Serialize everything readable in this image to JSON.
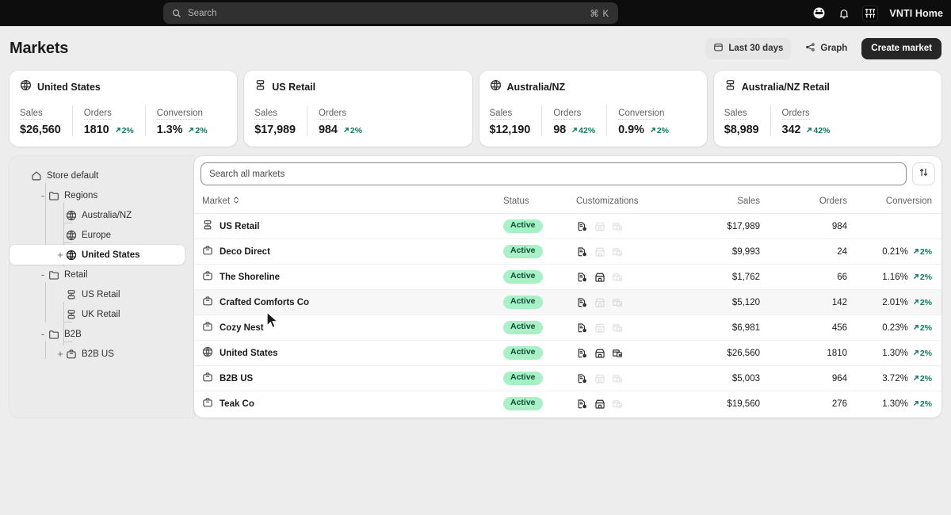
{
  "topbar": {
    "search": {
      "placeholder": "Search",
      "shortcut": "⌘ K",
      "icon": "search-icon"
    },
    "icons": [
      "inbox-icon",
      "bell-icon"
    ],
    "logo_icon": "store-logo-icon",
    "store_name": "VNTI Home"
  },
  "header": {
    "title": "Markets",
    "date_range_button": {
      "label": "Last 30 days",
      "icon": "calendar-icon"
    },
    "graph_button": {
      "label": "Graph",
      "icon": "share-nodes-icon"
    },
    "create_button": {
      "label": "Create market"
    }
  },
  "colors": {
    "page_bg": "#ededed",
    "topbar_bg": "#0d0d0d",
    "card_bg": "#ffffff",
    "primary_button_bg": "#262626",
    "positive_delta": "#0e7a5f",
    "badge_bg": "#a8f0c6",
    "badge_text": "#0b4f36"
  },
  "cards": [
    {
      "title": "United States",
      "icon": "globe-icon",
      "metrics": [
        {
          "label": "Sales",
          "value": "$26,560",
          "delta": null
        },
        {
          "label": "Orders",
          "value": "1810",
          "delta": "2%",
          "delta_dir": "up"
        },
        {
          "label": "Conversion",
          "value": "1.3%",
          "delta": "2%",
          "delta_dir": "up"
        }
      ]
    },
    {
      "title": "US Retail",
      "icon": "segment-icon",
      "metrics": [
        {
          "label": "Sales",
          "value": "$17,989",
          "delta": null
        },
        {
          "label": "Orders",
          "value": "984",
          "delta": "2%",
          "delta_dir": "up"
        }
      ]
    },
    {
      "title": "Australia/NZ",
      "icon": "globe-icon",
      "metrics": [
        {
          "label": "Sales",
          "value": "$12,190",
          "delta": null
        },
        {
          "label": "Orders",
          "value": "98",
          "delta": "42%",
          "delta_dir": "up"
        },
        {
          "label": "Conversion",
          "value": "0.9%",
          "delta": "2%",
          "delta_dir": "up"
        }
      ]
    },
    {
      "title": "Australia/NZ Retail",
      "icon": "segment-icon",
      "metrics": [
        {
          "label": "Sales",
          "value": "$8,989",
          "delta": null
        },
        {
          "label": "Orders",
          "value": "342",
          "delta": "42%",
          "delta_dir": "up"
        }
      ]
    }
  ],
  "tree": [
    {
      "label": "Store default",
      "icon": "home-icon",
      "depth": 0,
      "toggle": "",
      "selected": false
    },
    {
      "label": "Regions",
      "icon": "folder-icon",
      "depth": 1,
      "toggle": "-",
      "selected": false
    },
    {
      "label": "Australia/NZ",
      "icon": "globe-icon",
      "depth": 2,
      "toggle": "",
      "selected": false
    },
    {
      "label": "Europe",
      "icon": "globe-icon",
      "depth": 2,
      "toggle": "",
      "selected": false
    },
    {
      "label": "United States",
      "icon": "globe-icon",
      "depth": 2,
      "toggle": "+",
      "selected": true
    },
    {
      "label": "Retail",
      "icon": "folder-icon",
      "depth": 1,
      "toggle": "-",
      "selected": false
    },
    {
      "label": "US Retail",
      "icon": "segment-icon",
      "depth": 2,
      "toggle": "",
      "selected": false
    },
    {
      "label": "UK Retail",
      "icon": "segment-icon",
      "depth": 2,
      "toggle": "",
      "selected": false
    },
    {
      "label": "B2B",
      "icon": "folder-icon",
      "depth": 1,
      "toggle": "-",
      "selected": false
    },
    {
      "label": "B2B US",
      "icon": "briefcase-icon",
      "depth": 2,
      "toggle": "+",
      "selected": false
    }
  ],
  "table": {
    "search_placeholder": "Search all markets",
    "sort_button_icon": "sort-arrows-icon",
    "columns": [
      {
        "key": "market",
        "label": "Market",
        "sortable": true,
        "sort_icon": "chevron-updown-icon"
      },
      {
        "key": "status",
        "label": "Status",
        "sortable": false
      },
      {
        "key": "customizations",
        "label": "Customizations",
        "sortable": false
      },
      {
        "key": "sales",
        "label": "Sales",
        "sortable": false
      },
      {
        "key": "orders",
        "label": "Orders",
        "sortable": false
      },
      {
        "key": "conversion",
        "label": "Conversion",
        "sortable": false
      }
    ],
    "rows": [
      {
        "market": "US Retail",
        "icon": "segment-icon",
        "status": "Active",
        "customizations": [
          true,
          false,
          false
        ],
        "sales": "$17,989",
        "orders": "984",
        "conversion": "",
        "conv_delta": "",
        "hover": false
      },
      {
        "market": "Deco Direct",
        "icon": "briefcase-icon",
        "status": "Active",
        "customizations": [
          true,
          false,
          false
        ],
        "sales": "$9,993",
        "orders": "24",
        "conversion": "0.21%",
        "conv_delta": "2%",
        "hover": false
      },
      {
        "market": "The Shoreline",
        "icon": "briefcase-icon",
        "status": "Active",
        "customizations": [
          true,
          true,
          false
        ],
        "sales": "$1,762",
        "orders": "66",
        "conversion": "1.16%",
        "conv_delta": "2%",
        "hover": false
      },
      {
        "market": "Crafted Comforts Co",
        "icon": "briefcase-icon",
        "status": "Active",
        "customizations": [
          true,
          false,
          false
        ],
        "sales": "$5,120",
        "orders": "142",
        "conversion": "2.01%",
        "conv_delta": "2%",
        "hover": true
      },
      {
        "market": "Cozy Nest",
        "icon": "briefcase-icon",
        "status": "Active",
        "customizations": [
          true,
          false,
          false
        ],
        "sales": "$6,981",
        "orders": "456",
        "conversion": "0.23%",
        "conv_delta": "2%",
        "hover": false
      },
      {
        "market": "United States",
        "icon": "globe-icon",
        "status": "Active",
        "customizations": [
          true,
          true,
          true
        ],
        "sales": "$26,560",
        "orders": "1810",
        "conversion": "1.30%",
        "conv_delta": "2%",
        "hover": false
      },
      {
        "market": "B2B US",
        "icon": "briefcase-icon",
        "status": "Active",
        "customizations": [
          true,
          false,
          false
        ],
        "sales": "$5,003",
        "orders": "964",
        "conversion": "3.72%",
        "conv_delta": "2%",
        "hover": false
      },
      {
        "market": "Teak Co",
        "icon": "briefcase-icon",
        "status": "Active",
        "customizations": [
          true,
          true,
          false
        ],
        "sales": "$19,560",
        "orders": "276",
        "conversion": "1.30%",
        "conv_delta": "2%",
        "hover": false
      }
    ]
  }
}
